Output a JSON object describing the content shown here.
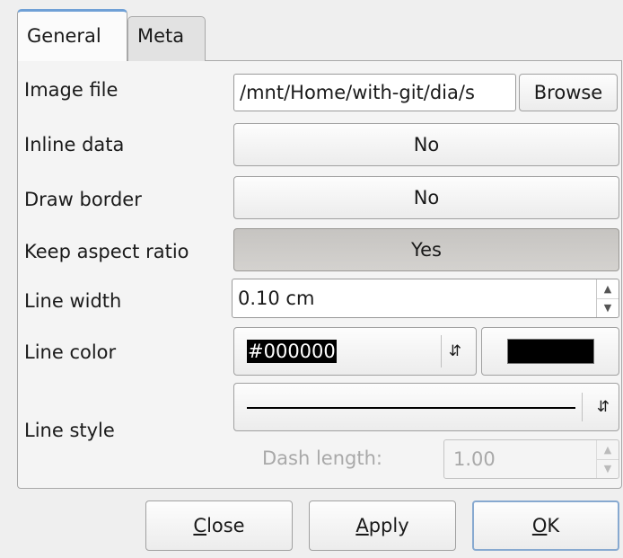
{
  "tabs": [
    {
      "label": "General",
      "active": true
    },
    {
      "label": "Meta",
      "active": false
    }
  ],
  "rows": {
    "image_file": {
      "label": "Image file",
      "value": "/mnt/Home/with-git/dia/s",
      "button": "Browse"
    },
    "inline_data": {
      "label": "Inline data",
      "value": "No"
    },
    "draw_border": {
      "label": "Draw border",
      "value": "No"
    },
    "keep_aspect": {
      "label": "Keep aspect ratio",
      "value": "Yes"
    },
    "line_width": {
      "label": "Line width",
      "value": "0.10 cm"
    },
    "line_color": {
      "label": "Line color",
      "value": "#000000",
      "swatch": "#000000"
    },
    "line_style": {
      "label": "Line style",
      "dash_label": "Dash length:",
      "dash_value": "1.00"
    }
  },
  "footer": {
    "close_prefix": "C",
    "close_rest": "lose",
    "apply_prefix": "A",
    "apply_rest": "pply",
    "ok_prefix": "O",
    "ok_rest": "K"
  },
  "colors": {
    "tab_accent": "#6fa0d6",
    "focus_border": "#87a9d0"
  }
}
